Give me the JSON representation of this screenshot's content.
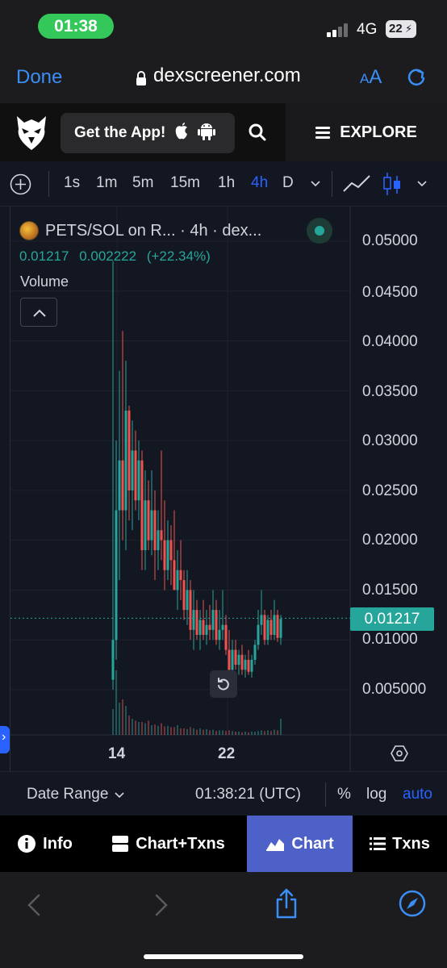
{
  "status_bar": {
    "time": "01:38",
    "network": "4G",
    "battery": "22"
  },
  "browser": {
    "done_label": "Done",
    "url": "dexscreener.com",
    "reader_label_small": "A",
    "reader_label_large": "A"
  },
  "header": {
    "get_app_label": "Get the App!",
    "explore_label": "EXPLORE"
  },
  "toolbar": {
    "timeframes": [
      "1s",
      "1m",
      "5m",
      "15m",
      "1h",
      "4h",
      "D"
    ],
    "active_timeframe": "4h"
  },
  "chart": {
    "legend_title": "PETS/SOL on R... · 4h · dex...",
    "ohlc_close": "0.01217",
    "ohlc_change": "0.002222",
    "ohlc_change_pct": "(+22.34%)",
    "volume_label": "Volume",
    "price_tag": "0.01217",
    "up_color": "#26a69a",
    "down_color": "#ef5350"
  },
  "chart_data": {
    "type": "candlestick",
    "title": "PETS/SOL on R... · 4h · dex...",
    "y_ticks": [
      "0.05000",
      "0.04500",
      "0.04000",
      "0.03500",
      "0.03000",
      "0.02500",
      "0.02000",
      "0.01500",
      "0.01000",
      "0.005000"
    ],
    "ylim": [
      0.0035,
      0.051
    ],
    "x_ticks": [
      "14",
      "22"
    ],
    "last_price": 0.01217,
    "candles": [
      [
        0.006,
        0.048,
        0.005,
        0.01
      ],
      [
        0.01,
        0.03,
        0.008,
        0.023
      ],
      [
        0.023,
        0.037,
        0.016,
        0.028
      ],
      [
        0.028,
        0.041,
        0.02,
        0.023
      ],
      [
        0.023,
        0.038,
        0.019,
        0.033
      ],
      [
        0.033,
        0.0335,
        0.022,
        0.025
      ],
      [
        0.025,
        0.032,
        0.021,
        0.029
      ],
      [
        0.029,
        0.031,
        0.023,
        0.024
      ],
      [
        0.024,
        0.03,
        0.022,
        0.028
      ],
      [
        0.028,
        0.029,
        0.017,
        0.019
      ],
      [
        0.019,
        0.027,
        0.017,
        0.024
      ],
      [
        0.024,
        0.026,
        0.019,
        0.02
      ],
      [
        0.02,
        0.027,
        0.0185,
        0.023
      ],
      [
        0.023,
        0.025,
        0.016,
        0.019
      ],
      [
        0.019,
        0.023,
        0.017,
        0.021
      ],
      [
        0.021,
        0.029,
        0.018,
        0.02
      ],
      [
        0.02,
        0.024,
        0.015,
        0.017
      ],
      [
        0.017,
        0.022,
        0.016,
        0.02
      ],
      [
        0.02,
        0.0215,
        0.0155,
        0.018
      ],
      [
        0.018,
        0.023,
        0.0165,
        0.015
      ],
      [
        0.015,
        0.019,
        0.013,
        0.017
      ],
      [
        0.017,
        0.02,
        0.014,
        0.016
      ],
      [
        0.016,
        0.017,
        0.012,
        0.013
      ],
      [
        0.013,
        0.017,
        0.0115,
        0.015
      ],
      [
        0.015,
        0.016,
        0.01,
        0.011
      ],
      [
        0.011,
        0.015,
        0.009,
        0.013
      ],
      [
        0.013,
        0.014,
        0.01,
        0.0105
      ],
      [
        0.0105,
        0.013,
        0.009,
        0.012
      ],
      [
        0.012,
        0.014,
        0.01,
        0.0105
      ],
      [
        0.0105,
        0.013,
        0.0095,
        0.0115
      ],
      [
        0.0115,
        0.0135,
        0.01,
        0.011
      ],
      [
        0.011,
        0.015,
        0.01,
        0.013
      ],
      [
        0.013,
        0.014,
        0.0095,
        0.01
      ],
      [
        0.01,
        0.013,
        0.009,
        0.011
      ],
      [
        0.011,
        0.015,
        0.01,
        0.0115
      ],
      [
        0.0115,
        0.0125,
        0.0085,
        0.009
      ],
      [
        0.009,
        0.011,
        0.006,
        0.007
      ],
      [
        0.007,
        0.01,
        0.006,
        0.009
      ],
      [
        0.009,
        0.01,
        0.007,
        0.0075
      ],
      [
        0.0075,
        0.009,
        0.0065,
        0.0085
      ],
      [
        0.0085,
        0.0095,
        0.0065,
        0.007
      ],
      [
        0.007,
        0.0085,
        0.0062,
        0.008
      ],
      [
        0.008,
        0.009,
        0.0065,
        0.0068
      ],
      [
        0.0068,
        0.0085,
        0.0062,
        0.008
      ],
      [
        0.008,
        0.01,
        0.0075,
        0.0095
      ],
      [
        0.0095,
        0.013,
        0.009,
        0.0115
      ],
      [
        0.0115,
        0.015,
        0.0105,
        0.0125
      ],
      [
        0.0125,
        0.013,
        0.0095,
        0.01
      ],
      [
        0.01,
        0.0125,
        0.0095,
        0.012
      ],
      [
        0.012,
        0.013,
        0.01,
        0.0105
      ],
      [
        0.0105,
        0.014,
        0.01,
        0.0125
      ],
      [
        0.0125,
        0.013,
        0.0098,
        0.0102
      ],
      [
        0.0102,
        0.0125,
        0.0095,
        0.0121
      ]
    ],
    "volume": [
      0.4,
      1.0,
      0.5,
      0.55,
      0.45,
      0.3,
      0.25,
      0.22,
      0.2,
      0.2,
      0.18,
      0.22,
      0.15,
      0.16,
      0.14,
      0.18,
      0.13,
      0.14,
      0.12,
      0.12,
      0.15,
      0.1,
      0.1,
      0.09,
      0.12,
      0.1,
      0.08,
      0.1,
      0.08,
      0.09,
      0.07,
      0.08,
      0.06,
      0.07,
      0.07,
      0.06,
      0.07,
      0.06,
      0.05,
      0.05,
      0.04,
      0.05,
      0.04,
      0.05,
      0.05,
      0.06,
      0.07,
      0.06,
      0.07,
      0.06,
      0.08,
      0.07,
      0.25
    ]
  },
  "range_row": {
    "date_range_label": "Date Range",
    "clock": "01:38:21 (UTC)",
    "pct_label": "%",
    "log_label": "log",
    "auto_label": "auto"
  },
  "bottom_tabs": [
    {
      "label": "Info",
      "icon": "info-icon"
    },
    {
      "label": "Chart+Txns",
      "icon": "split-icon"
    },
    {
      "label": "Chart",
      "icon": "chart-icon",
      "active": true
    },
    {
      "label": "Txns",
      "icon": "list-icon"
    }
  ]
}
